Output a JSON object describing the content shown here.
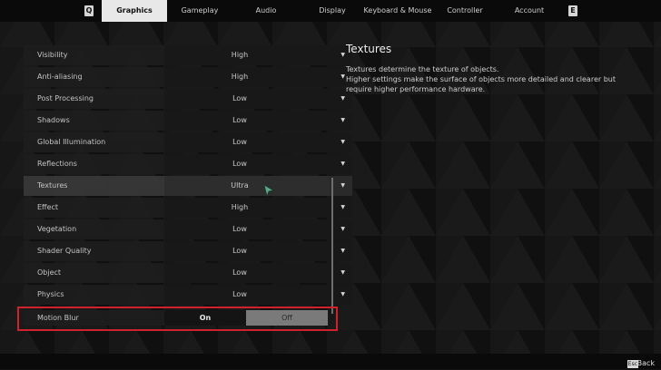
{
  "nav": {
    "left_key": "Q",
    "right_key": "E",
    "tabs": [
      {
        "label": "Graphics",
        "active": true
      },
      {
        "label": "Gameplay",
        "active": false
      },
      {
        "label": "Audio",
        "active": false
      },
      {
        "label": "Display",
        "active": false
      },
      {
        "label": "Keyboard & Mouse",
        "active": false
      },
      {
        "label": "Controller",
        "active": false
      },
      {
        "label": "Account",
        "active": false
      }
    ]
  },
  "settings": [
    {
      "label": "Visibility",
      "value": "High"
    },
    {
      "label": "Anti-aliasing",
      "value": "High"
    },
    {
      "label": "Post Processing",
      "value": "Low"
    },
    {
      "label": "Shadows",
      "value": "Low"
    },
    {
      "label": "Global Illumination",
      "value": "Low"
    },
    {
      "label": "Reflections",
      "value": "Low"
    },
    {
      "label": "Textures",
      "value": "Ultra"
    },
    {
      "label": "Effect",
      "value": "High"
    },
    {
      "label": "Vegetation",
      "value": "Low"
    },
    {
      "label": "Shader Quality",
      "value": "Low"
    },
    {
      "label": "Object",
      "value": "Low"
    },
    {
      "label": "Physics",
      "value": "Low"
    }
  ],
  "motion_blur": {
    "label": "Motion Blur",
    "on_label": "On",
    "off_label": "Off"
  },
  "description": {
    "title": "Textures",
    "line1": "Textures determine the texture of objects.",
    "line2": "Higher settings make the surface of objects more detailed and clearer but require higher performance hardware."
  },
  "footer": {
    "esc_key": "Esc",
    "back_label": "Back"
  },
  "icons": {
    "dropdown": "caret-down-icon",
    "cursor": "mouse-cursor-icon"
  },
  "colors": {
    "highlight": "#d0222c",
    "active_tab": "#e8e8e8",
    "cursor": "#5fa88a"
  }
}
